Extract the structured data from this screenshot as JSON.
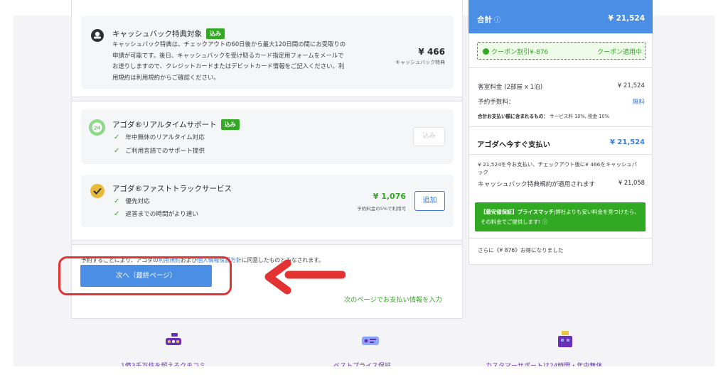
{
  "cashback": {
    "title": "キャッシュバック特典対象",
    "badge": "込み",
    "description_lines": [
      "キャッシュバック特典は、チェックアウトの60日後から最大120日間の間にお受取りの",
      "申請が可能です。後日、キャッシュバックを受け取るカード指定用フォームをメールで",
      "お送りしますので、クレジットカードまたはデビットカード情報をご記入ください。利",
      "用規約は利用規約からご確認ください。"
    ],
    "price": "¥ 466",
    "price_label": "キャッシュバック特典"
  },
  "realtime_support": {
    "title": "アゴダ®リアルタイムサポート",
    "badge": "込み",
    "features": [
      "年中無休のリアルタイム対応",
      "ご利用言語でのサポート提供"
    ],
    "button_label": "込み"
  },
  "fast_track": {
    "title": "アゴダ®ファストトラックサービス",
    "features": [
      "優先対応",
      "返答までの時間がより速い"
    ],
    "price": "¥ 1,076",
    "price_note": "予約料金の5%で利用可",
    "button_label": "追加"
  },
  "terms": {
    "prefix": "予約することにより、アゴダの",
    "link1": "利用規約",
    "middle": "および",
    "link2": "個人情報保護方針",
    "suffix": "に同意したものとみなされます。"
  },
  "next_button_label": "次へ（最終ページ）",
  "payment_note": "次のページでお支払い情報を入力",
  "summary": {
    "total_label": "合計",
    "total_info_icon": "info-icon",
    "total_value": "¥ 21,524",
    "coupon_label": "クーポン割引¥-876",
    "coupon_status": "クーポン適用中",
    "room_label": "客室料金 (2部屋 x 1泊)",
    "room_value": "¥ 21,524",
    "fee_label": "予約手数料：",
    "fee_value": "無料",
    "taxes_label": "合計お支払い額に含まれるもの：",
    "taxes_value": "サービス料 10%, 税金 10%",
    "paynow_label": "アゴダへ今すぐ支払い",
    "paynow_value": "¥ 21,524",
    "cashback_note": "¥ 21,524を今お支払い、チェックアウト後に¥ 466をキャッシュバック",
    "cashback_terms": "キャッシュバック特典規約が適用されます",
    "cashback_terms_value": "¥ 21,058",
    "pricematch_title": "【最安値保証】プライスマッチ",
    "pricematch_text": "|弊社よりも安い料金を見つけたら、その料金でご提供します!",
    "savings": "さらに《¥ 876》お得になりました"
  },
  "footer": {
    "items": [
      "1億3千万件を超えるクチコミ",
      "ベストプライス保証",
      "カスタマーサポートは24時間・年中無休"
    ]
  },
  "colors": {
    "accent_blue": "#4a8ee6",
    "green": "#32a923",
    "highlight_red": "#e23232",
    "footer_purple": "#6b2fb7"
  }
}
